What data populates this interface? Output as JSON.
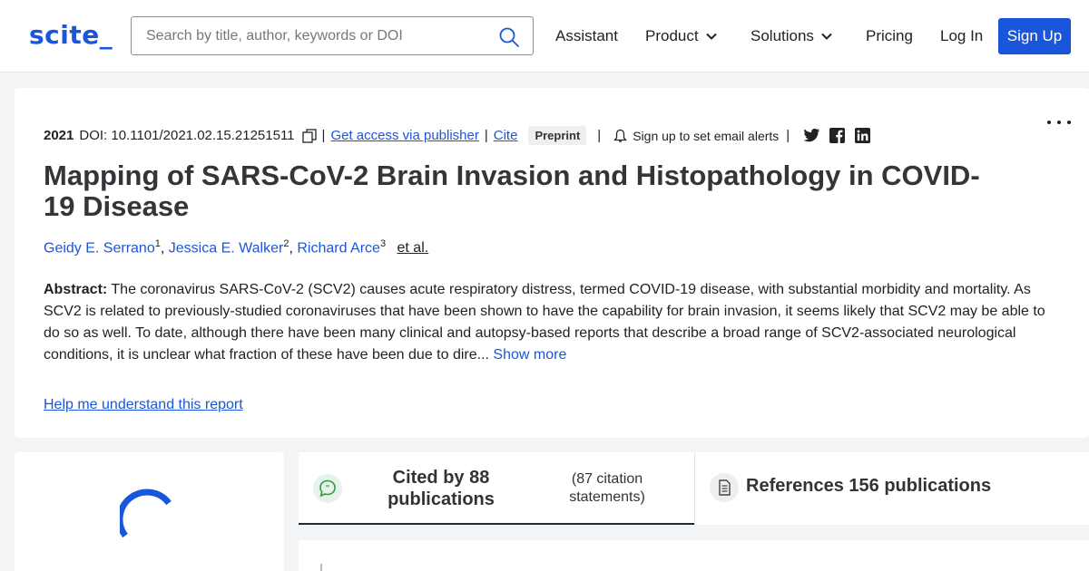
{
  "header": {
    "logo": "scite_",
    "search_placeholder": "Search by title, author, keywords or DOI",
    "nav": {
      "assistant": "Assistant",
      "product": "Product",
      "solutions": "Solutions",
      "pricing": "Pricing",
      "login": "Log In",
      "signup": "Sign Up"
    }
  },
  "paper": {
    "year": "2021",
    "doi": "DOI: 10.1101/2021.02.15.21251511",
    "separator": "|",
    "access_link": "Get access via publisher",
    "cite_link": "Cite",
    "badge": "Preprint",
    "alerts": "Sign up to set email alerts",
    "title": "Mapping of SARS-CoV-2 Brain Invasion and Histopathology in COVID-19 Disease",
    "authors": [
      {
        "name": "Geidy E. Serrano",
        "sup": "1"
      },
      {
        "name": "Jessica E. Walker",
        "sup": "2"
      },
      {
        "name": "Richard Arce",
        "sup": "3"
      }
    ],
    "comma": ",",
    "et_al": "et al.",
    "abstract_label": "Abstract:",
    "abstract_text": " The coronavirus SARS-CoV-2 (SCV2) causes acute respiratory distress, termed COVID-19 disease, with substantial morbidity and mortality. As SCV2 is related to previously-studied coronaviruses that have been shown to have the capability for brain invasion, it seems likely that SCV2 may be able to do so as well. To date, although there have been many clinical and autopsy-based reports that describe a broad range of SCV2-associated neurological conditions, it is unclear what fraction of these have been due to dire...",
    "show_more": " Show more",
    "help_link": "Help me understand this report"
  },
  "tabs": {
    "cited_title": "Cited by 88 publications",
    "cited_sub": "(87 citation statements)",
    "refs_title": "References 156 publications"
  },
  "colors": {
    "brand": "#1a56db",
    "tab_active": "#1f2937"
  }
}
